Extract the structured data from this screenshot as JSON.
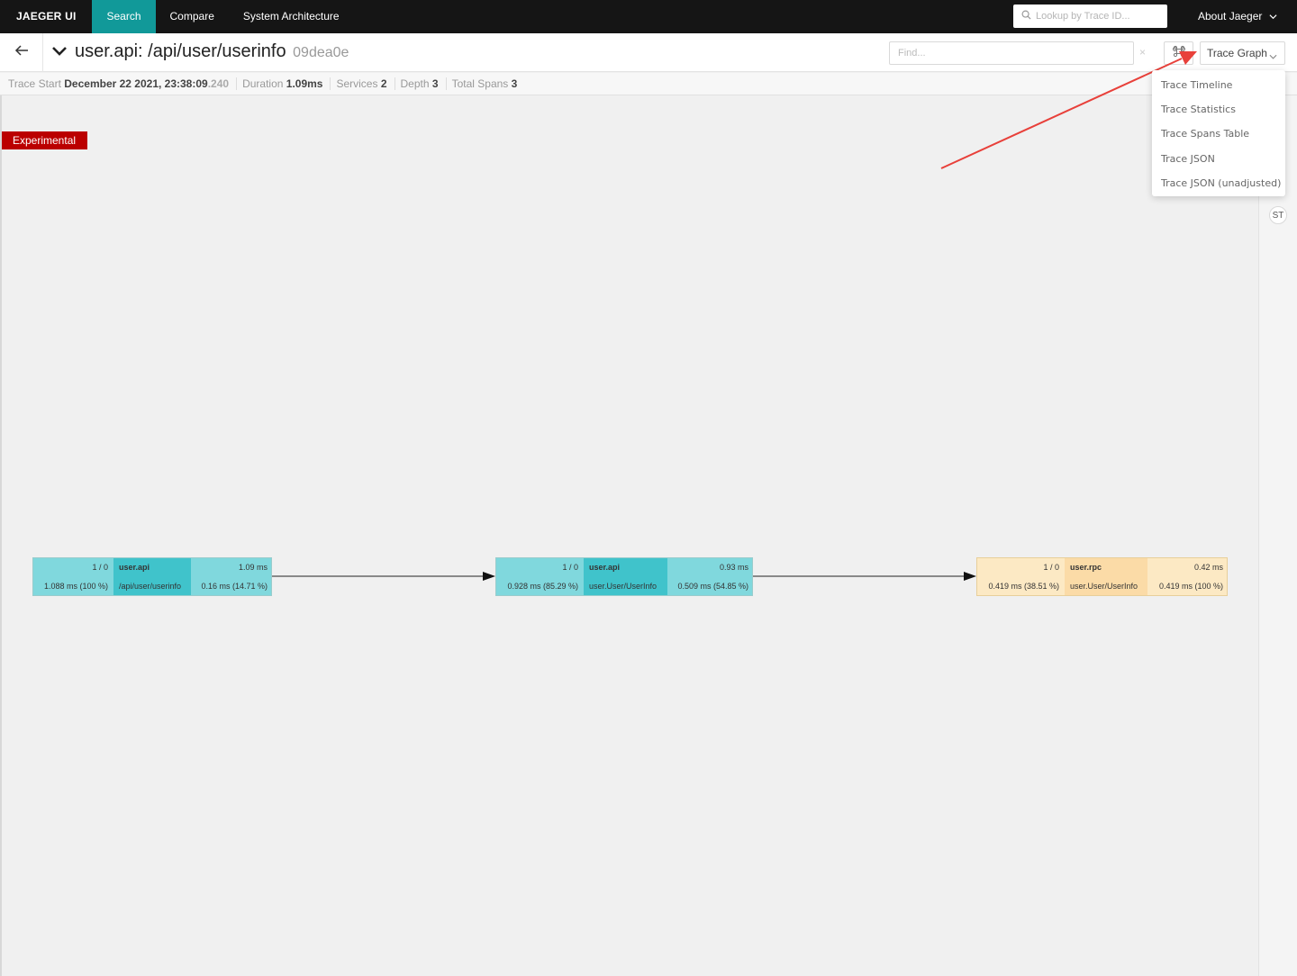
{
  "nav": {
    "brand": "JAEGER UI",
    "links": [
      "Search",
      "Compare",
      "System Architecture"
    ],
    "lookup_placeholder": "Lookup by Trace ID...",
    "about": "About Jaeger"
  },
  "trace": {
    "title": "user.api: /api/user/userinfo",
    "trace_id": "09dea0e",
    "find_placeholder": "Find...",
    "clear": "×",
    "view_selected": "Trace Graph"
  },
  "summary": {
    "start_label": "Trace Start",
    "start_value": "December 22 2021, 23:38:09",
    "start_ms": ".240",
    "duration_label": "Duration",
    "duration_value": "1.09ms",
    "services_label": "Services",
    "services_value": "2",
    "depth_label": "Depth",
    "depth_value": "3",
    "spans_label": "Total Spans",
    "spans_value": "3"
  },
  "menu": [
    "Trace Timeline",
    "Trace Statistics",
    "Trace Spans Table",
    "Trace JSON",
    "Trace JSON (unadjusted)"
  ],
  "badge": "Experimental",
  "rail": {
    "st": "ST"
  },
  "nodes": [
    {
      "count": "1 / 0",
      "service": "user.api",
      "total": "1.09 ms",
      "total_detail": "1.088 ms (100 %)",
      "operation": "/api/user/userinfo",
      "self": "0.16 ms (14.71 %)",
      "tone": "teal"
    },
    {
      "count": "1 / 0",
      "service": "user.api",
      "total": "0.93 ms",
      "total_detail": "0.928 ms (85.29 %)",
      "operation": "user.User/UserInfo",
      "self": "0.509 ms (54.85 %)",
      "tone": "teal"
    },
    {
      "count": "1 / 0",
      "service": "user.rpc",
      "total": "0.42 ms",
      "total_detail": "0.419 ms (38.51 %)",
      "operation": "user.User/UserInfo",
      "self": "0.419 ms (100 %)",
      "tone": "amber"
    }
  ],
  "colors": {
    "nav_bg": "#151515",
    "active_tab": "#119999",
    "badge": "#bb0000",
    "annotation_arrow": "#e8403a"
  }
}
